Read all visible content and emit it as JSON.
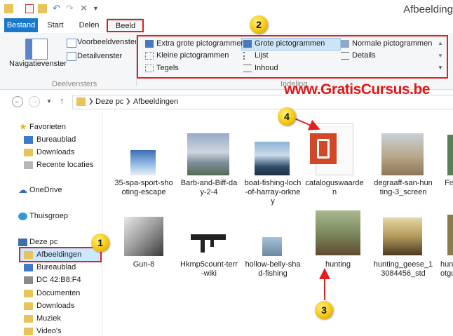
{
  "window": {
    "title": "Afbeelding"
  },
  "tabs": {
    "file": "Bestand",
    "start": "Start",
    "share": "Delen",
    "view": "Beeld"
  },
  "ribbon": {
    "panes": {
      "navigation": "Navigatievenster",
      "preview": "Voorbeeldvenster",
      "details": "Detailvenster",
      "group": "Deelvensters"
    },
    "layout": {
      "extra_large": "Extra grote pictogrammen",
      "large": "Grote pictogrammen",
      "medium": "Normale pictogrammen",
      "small": "Kleine pictogrammen",
      "list": "Lijst",
      "details": "Details",
      "tiles": "Tegels",
      "content": "Inhoud",
      "group": "Indeling"
    }
  },
  "watermark": "www.GratisCursus.be",
  "breadcrumb": {
    "root": "Deze pc",
    "folder": "Afbeeldingen"
  },
  "nav": {
    "favorites": "Favorieten",
    "desktop": "Bureaublad",
    "downloads": "Downloads",
    "recent": "Recente locaties",
    "onedrive": "OneDrive",
    "homegroup": "Thuisgroep",
    "this_pc": "Deze pc",
    "pictures": "Afbeeldingen",
    "desktop2": "Bureaublad",
    "dc": "DC 42:B8:F4",
    "documents": "Documenten",
    "downloads2": "Downloads",
    "music": "Muziek",
    "videos": "Video's"
  },
  "files": [
    {
      "name": "35-spa-sport-sho\noting-escape"
    },
    {
      "name": "Barb-and-Biff-da\ny-2-4"
    },
    {
      "name": "boat-fishing-loch\n-of-harray-orkne\ny"
    },
    {
      "name": "cataloguswaarde\nn"
    },
    {
      "name": "degraaff-san-hun\nting-3_screen"
    },
    {
      "name": "Fis"
    },
    {
      "name": "Gun-8"
    },
    {
      "name": "Hkmp5count-terr\n-wiki"
    },
    {
      "name": "hollow-belly-sha\nd-fishing"
    },
    {
      "name": "hunting"
    },
    {
      "name": "hunting_geese_1\n3084456_std"
    },
    {
      "name": "hun\notgu"
    }
  ],
  "badges": {
    "b1": "1",
    "b2": "2",
    "b3": "3",
    "b4": "4"
  },
  "colors": {
    "accent": "#1979ca",
    "annotation": "#e02020",
    "selection": "#cce8ff"
  }
}
